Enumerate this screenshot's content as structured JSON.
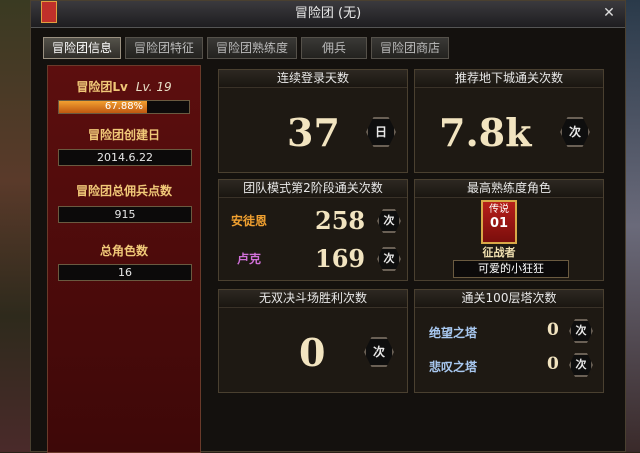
{
  "window": {
    "title": "冒险团 (无)"
  },
  "tabs": [
    {
      "label": "冒险团信息",
      "active": true
    },
    {
      "label": "冒险团特征",
      "active": false
    },
    {
      "label": "冒险团熟练度",
      "active": false
    },
    {
      "label": "佣兵",
      "active": false
    },
    {
      "label": "冒险团商店",
      "active": false
    }
  ],
  "left_panel": {
    "level_label": "冒险团Lv",
    "level_value": "Lv. 19",
    "exp_text": "67.88%",
    "exp_progress": 0.6788,
    "created_label": "冒险团创建日",
    "created_date": "2014.6.22",
    "mercenary_label": "冒险团总佣兵点数",
    "mercenary_points": "915",
    "characters_label": "总角色数",
    "characters_count": "16"
  },
  "cards": {
    "login_days": {
      "title": "连续登录天数",
      "value": "37",
      "unit": "日"
    },
    "dungeon_clears": {
      "title": "推荐地下城通关次数",
      "value": "7.8k",
      "unit": "次"
    },
    "team_mode": {
      "title": "团队模式第2阶段通关次数",
      "rows": [
        {
          "name": "安徒恩",
          "value": "258",
          "unit": "次"
        },
        {
          "name": "卢克",
          "value": "169",
          "unit": "次"
        }
      ]
    },
    "top_character": {
      "title": "最高熟练度角色",
      "badge_top": "传说",
      "badge_num": "01",
      "class_name": "征战者",
      "character_name": "可爱的小狂狂"
    },
    "arena_wins": {
      "title": "无双决斗场胜利次数",
      "value": "0",
      "unit": "次"
    },
    "tower_clears": {
      "title": "通关100层塔次数",
      "rows": [
        {
          "name": "绝望之塔",
          "value": "0",
          "unit": "次"
        },
        {
          "name": "悲叹之塔",
          "value": "0",
          "unit": "次"
        }
      ]
    }
  },
  "colors": {
    "left_panel_bg": "#5c0e0e",
    "gold_label": "#f0c878",
    "exp_fill": "#f2a030",
    "anton_label": "#f0a030",
    "luke_label": "#d070d8",
    "tower_label": "#a8c8f0"
  },
  "icons": {
    "close": "close-icon",
    "banner": "banner-icon"
  }
}
